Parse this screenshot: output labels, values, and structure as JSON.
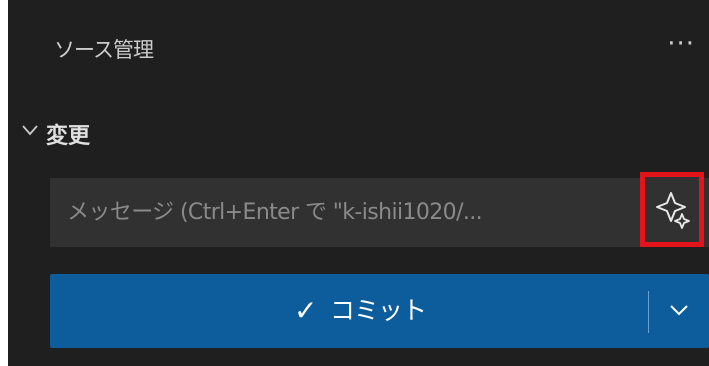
{
  "panel": {
    "title": "ソース管理",
    "more_actions": "···"
  },
  "changes": {
    "label": "変更",
    "expanded": true
  },
  "commit_message": {
    "value": "",
    "placeholder": "メッセージ (Ctrl+Enter で \"k-ishii1020/..."
  },
  "generate_button": {
    "icon": "sparkle-icon",
    "highlight_color": "#e3141c"
  },
  "commit_button": {
    "check": "✓",
    "label": "コミット",
    "color": "#0d5d9c"
  }
}
